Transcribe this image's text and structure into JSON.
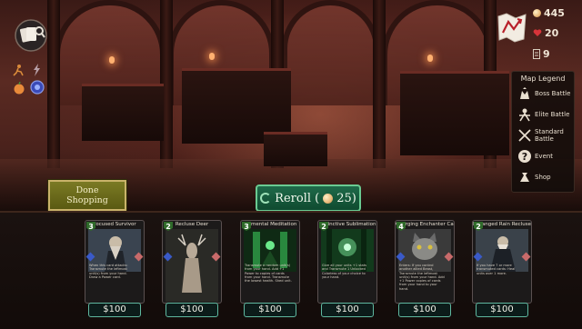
{
  "stats": {
    "gold": "445",
    "health": "20",
    "deck": "9"
  },
  "legend": {
    "title": "Map Legend",
    "items": [
      {
        "label": "Boss Battle",
        "icon": "boss-icon"
      },
      {
        "label": "Elite Battle",
        "icon": "elite-icon"
      },
      {
        "label": "Standard Battle",
        "icon": "swords-icon"
      },
      {
        "label": "Event",
        "icon": "question-icon"
      },
      {
        "label": "Shop",
        "icon": "bag-icon"
      }
    ]
  },
  "buttons": {
    "done_line1": "Done",
    "done_line2": "Shopping",
    "reroll_label": "Reroll (",
    "reroll_cost": "25)"
  },
  "cards": [
    {
      "title": "Focused Survivor",
      "cost": "3",
      "text": "When this card attacks: Transmute the leftmost unit(s) from your hand. Draw a Power card.",
      "price": "$100",
      "art": "survivor"
    },
    {
      "title": "Recluse Deer",
      "cost": "2",
      "text": "",
      "price": "$100",
      "art": "deer"
    },
    {
      "title": "Elemental Meditation",
      "cost": "3",
      "text": "Transmute a random unit(s) from your hand. Add +1 Power to copies of cards from your hand. Transmute the lowest health. Shed unit.",
      "price": "$100",
      "art": "meditation"
    },
    {
      "title": "Instinctive Sublimation",
      "cost": "2",
      "text": "Give all your units +1 stats and Transmute 1 Unlocked Colorless of your choice to your hand.",
      "price": "$100",
      "art": "forest"
    },
    {
      "title": "Charging Enchanter Cat",
      "cost": "4",
      "text": "Enters: If you control another allied Beast, Transmute the leftmost unit(s) from your hand. Add +1 Power copies of cards from your hand to your hand.",
      "price": "$100",
      "art": "cat"
    },
    {
      "title": "Deranged Rain Recluse",
      "cost": "2",
      "text": "If you have 7 or more transmuted cards: Heal units over 1 more.",
      "price": "$100",
      "art": "recluse"
    }
  ],
  "colors": {
    "accent": "#6acb92",
    "gold": "#e8b878",
    "health": "#d8343a"
  }
}
